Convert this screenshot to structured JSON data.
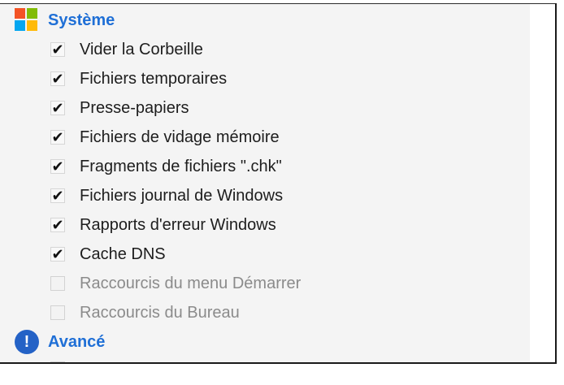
{
  "sections": {
    "system": {
      "title": "Système",
      "icon": "windows-logo-icon",
      "items": [
        {
          "label": "Vider la Corbeille",
          "checked": true,
          "enabled": true
        },
        {
          "label": "Fichiers temporaires",
          "checked": true,
          "enabled": true
        },
        {
          "label": "Presse-papiers",
          "checked": true,
          "enabled": true
        },
        {
          "label": "Fichiers de vidage mémoire",
          "checked": true,
          "enabled": true
        },
        {
          "label": "Fragments de fichiers \".chk\"",
          "checked": true,
          "enabled": true
        },
        {
          "label": "Fichiers journal de Windows",
          "checked": true,
          "enabled": true
        },
        {
          "label": "Rapports d'erreur Windows",
          "checked": true,
          "enabled": true
        },
        {
          "label": "Cache DNS",
          "checked": true,
          "enabled": true
        },
        {
          "label": "Raccourcis du menu Démarrer",
          "checked": false,
          "enabled": false
        },
        {
          "label": "Raccourcis du Bureau",
          "checked": false,
          "enabled": false
        }
      ]
    },
    "advanced": {
      "title": "Avancé",
      "icon": "exclamation-icon"
    }
  },
  "colors": {
    "section_title": "#1f6fd6",
    "advanced_icon": "#2462c6",
    "panel_background": "#f4f4f4",
    "enabled_text": "#1d1d1d",
    "disabled_text": "#8b8b8b"
  }
}
